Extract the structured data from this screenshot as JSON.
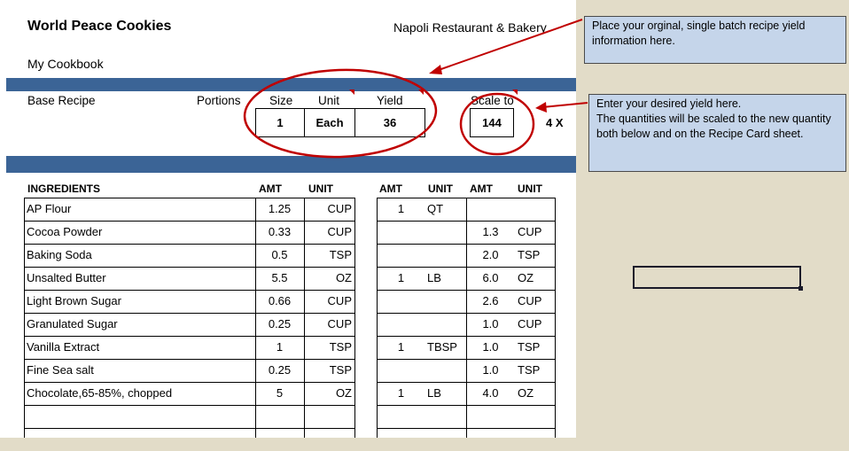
{
  "recipe": {
    "title": "World Peace Cookies",
    "restaurant": "Napoli Restaurant & Bakery",
    "cookbook": "My Cookbook",
    "base_label": "Base Recipe",
    "portions_label": "Portions",
    "size_label": "Size",
    "unit_label": "Unit",
    "yield_label": "Yield",
    "scale_label": "Scale to",
    "size_value": "1",
    "unit_value": "Each",
    "yield_value": "36",
    "scale_value": "144",
    "multiplier": "4 X"
  },
  "table": {
    "headers": {
      "ingredients": "INGREDIENTS",
      "amt1": "AMT",
      "unit1": "UNIT",
      "amt2": "AMT",
      "unit2": "UNIT",
      "amt3": "AMT",
      "unit3": "UNIT"
    },
    "rows": [
      {
        "name": "AP Flour",
        "amt": "1.25",
        "unit": "CUP",
        "conv_amt": "1",
        "conv_unit": "QT",
        "scaled_amt": "",
        "scaled_unit": ""
      },
      {
        "name": "Cocoa Powder",
        "amt": "0.33",
        "unit": "CUP",
        "conv_amt": "",
        "conv_unit": "",
        "scaled_amt": "1.3",
        "scaled_unit": "CUP"
      },
      {
        "name": "Baking Soda",
        "amt": "0.5",
        "unit": "TSP",
        "conv_amt": "",
        "conv_unit": "",
        "scaled_amt": "2.0",
        "scaled_unit": "TSP"
      },
      {
        "name": "Unsalted Butter",
        "amt": "5.5",
        "unit": "OZ",
        "conv_amt": "1",
        "conv_unit": "LB",
        "scaled_amt": "6.0",
        "scaled_unit": "OZ"
      },
      {
        "name": "Light Brown Sugar",
        "amt": "0.66",
        "unit": "CUP",
        "conv_amt": "",
        "conv_unit": "",
        "scaled_amt": "2.6",
        "scaled_unit": "CUP"
      },
      {
        "name": "Granulated Sugar",
        "amt": "0.25",
        "unit": "CUP",
        "conv_amt": "",
        "conv_unit": "",
        "scaled_amt": "1.0",
        "scaled_unit": "CUP"
      },
      {
        "name": "Vanilla Extract",
        "amt": "1",
        "unit": "TSP",
        "conv_amt": "1",
        "conv_unit": "TBSP",
        "scaled_amt": "1.0",
        "scaled_unit": "TSP"
      },
      {
        "name": "Fine Sea salt",
        "amt": "0.25",
        "unit": "TSP",
        "conv_amt": "",
        "conv_unit": "",
        "scaled_amt": "1.0",
        "scaled_unit": "TSP"
      },
      {
        "name": "Chocolate,65-85%, chopped",
        "amt": "5",
        "unit": "OZ",
        "conv_amt": "1",
        "conv_unit": "LB",
        "scaled_amt": "4.0",
        "scaled_unit": "OZ"
      },
      {
        "name": "",
        "amt": "",
        "unit": "",
        "conv_amt": "",
        "conv_unit": "",
        "scaled_amt": "",
        "scaled_unit": ""
      },
      {
        "name": "",
        "amt": "",
        "unit": "",
        "conv_amt": "",
        "conv_unit": "",
        "scaled_amt": "",
        "scaled_unit": ""
      }
    ]
  },
  "notes": {
    "yield_note": "Place your orginal, single batch recipe yield information here.",
    "scale_note": "Enter your desired yield here.\nThe quantities will be scaled to the new quantity both below and on the Recipe Card sheet."
  },
  "colors": {
    "band": "#3b6496",
    "annotation_red": "#c00000",
    "note_bg": "#c5d5ea",
    "background": "#e2dcc8"
  }
}
